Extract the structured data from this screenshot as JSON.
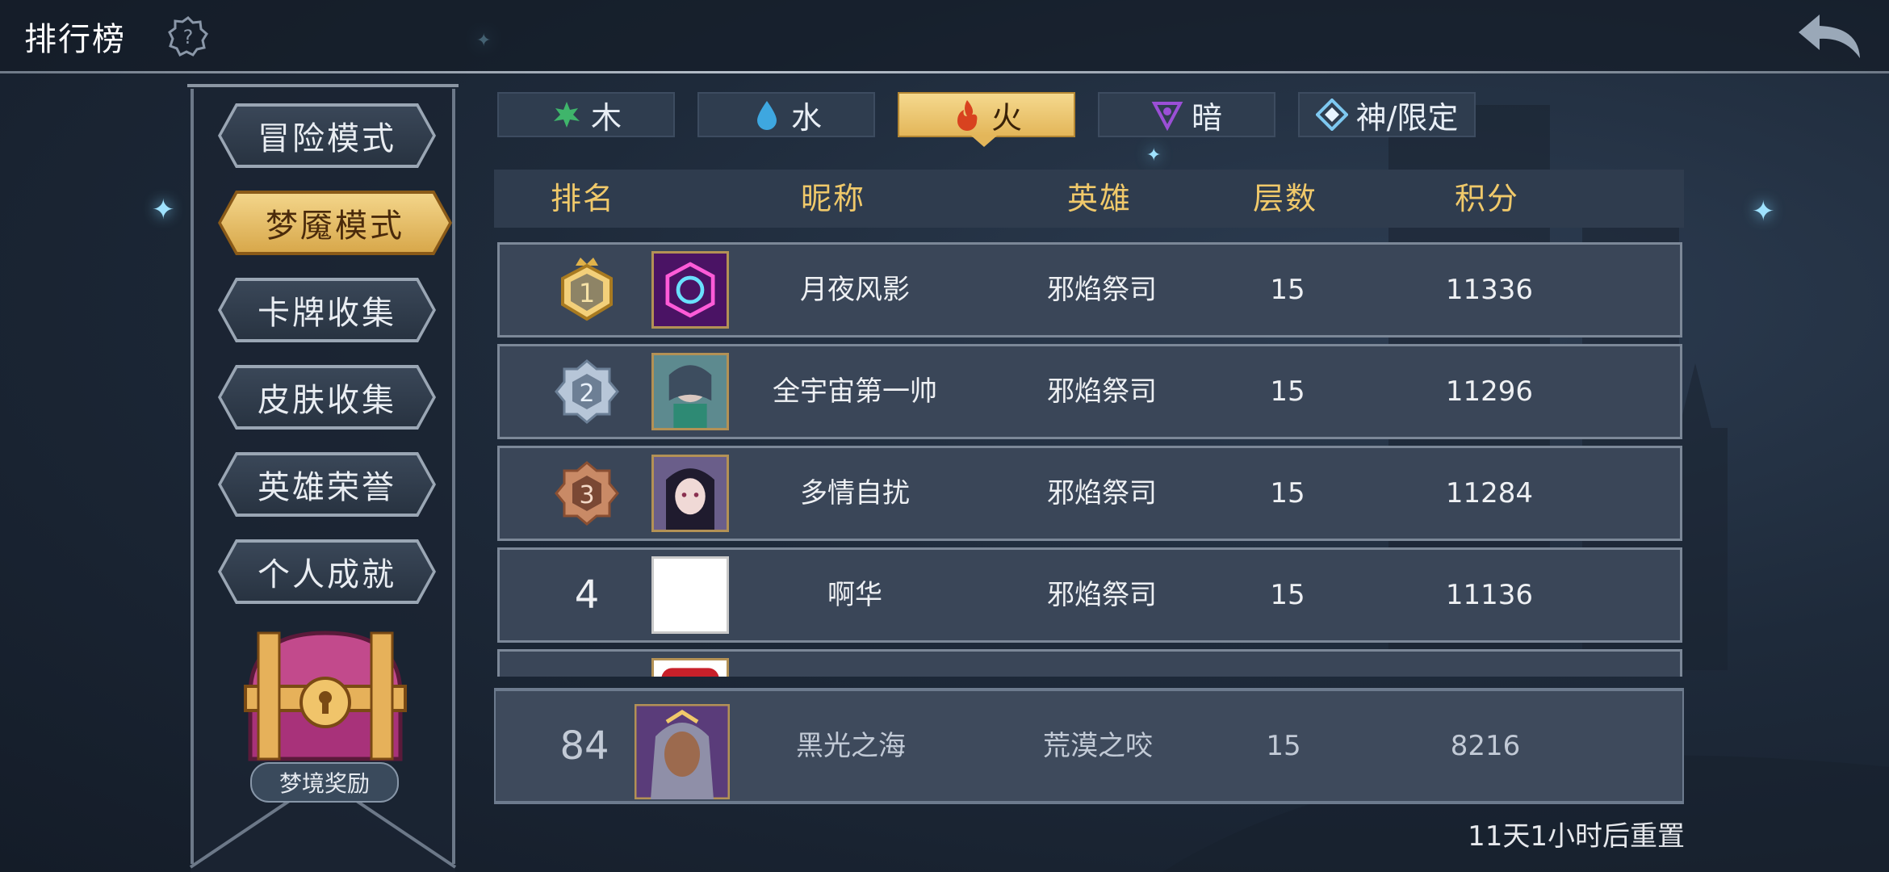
{
  "header": {
    "title": "排行榜",
    "help_icon": "question-gear-icon",
    "back_icon": "back-arrow-icon"
  },
  "sidebar": {
    "items": [
      {
        "label": "冒险模式",
        "active": false
      },
      {
        "label": "梦魇模式",
        "active": true
      },
      {
        "label": "卡牌收集",
        "active": false
      },
      {
        "label": "皮肤收集",
        "active": false
      },
      {
        "label": "英雄荣誉",
        "active": false
      },
      {
        "label": "个人成就",
        "active": false
      }
    ],
    "reward_label": "梦境奖励"
  },
  "tabs": [
    {
      "label": "木",
      "icon": "leaf-icon",
      "active": false
    },
    {
      "label": "水",
      "icon": "water-drop-icon",
      "active": false
    },
    {
      "label": "火",
      "icon": "fire-icon",
      "active": true
    },
    {
      "label": "暗",
      "icon": "dark-triangle-icon",
      "active": false
    },
    {
      "label": "神/限定",
      "icon": "diamond-rune-icon",
      "active": false
    }
  ],
  "table": {
    "headers": {
      "rank": "排名",
      "nickname": "昵称",
      "hero": "英雄",
      "floors": "层数",
      "score": "积分"
    },
    "rows": [
      {
        "rank": "1",
        "nickname": "月夜风影",
        "hero": "邪焰祭司",
        "floors": "15",
        "score": "11336"
      },
      {
        "rank": "2",
        "nickname": "全宇宙第一帅",
        "hero": "邪焰祭司",
        "floors": "15",
        "score": "11296"
      },
      {
        "rank": "3",
        "nickname": "多情自扰",
        "hero": "邪焰祭司",
        "floors": "15",
        "score": "11284"
      },
      {
        "rank": "4",
        "nickname": "啊华",
        "hero": "邪焰祭司",
        "floors": "15",
        "score": "11136"
      }
    ],
    "my_row": {
      "rank": "84",
      "nickname": "黑光之海",
      "hero": "荒漠之咬",
      "floors": "15",
      "score": "8216"
    }
  },
  "footer": {
    "reset_text": "11天1小时后重置"
  },
  "colors": {
    "gold": "#f0c96a",
    "active_tab": "#e3b65a",
    "panel": "#2f3c4e"
  }
}
